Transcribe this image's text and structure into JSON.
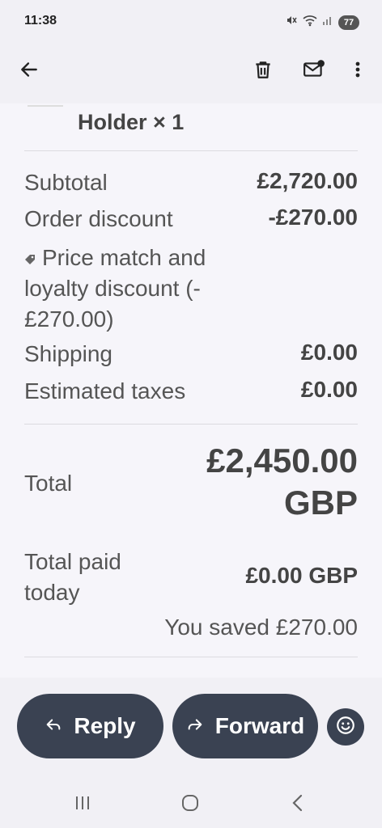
{
  "status_bar": {
    "time": "11:38",
    "battery": "77",
    "icons": [
      "mute-icon",
      "wifi-icon",
      "signal-icon",
      "battery-icon"
    ]
  },
  "app_bar": {
    "icons": [
      "back-arrow-icon",
      "trash-icon",
      "mark-unread-icon",
      "more-vert-icon"
    ]
  },
  "order": {
    "item_name": "Holder × 1",
    "rows": {
      "subtotal": {
        "label": "Subtotal",
        "value": "£2,720.00"
      },
      "order_discount": {
        "label": "Order discount",
        "value": "-£270.00"
      },
      "discount_note": "Price match and loyalty discount (-£270.00)",
      "shipping": {
        "label": "Shipping",
        "value": "£0.00"
      },
      "taxes": {
        "label": "Estimated taxes",
        "value": "£0.00"
      }
    },
    "total": {
      "label": "Total",
      "value": "£2,450.00 GBP"
    },
    "total_paid": {
      "label": "Total paid today",
      "value": "£0.00 GBP"
    },
    "saved": "You saved £270.00"
  },
  "actions": {
    "reply": "Reply",
    "forward": "Forward"
  },
  "colors": {
    "pill_bg": "#3a4252",
    "background": "#f6f5fa",
    "text": "#444444"
  }
}
